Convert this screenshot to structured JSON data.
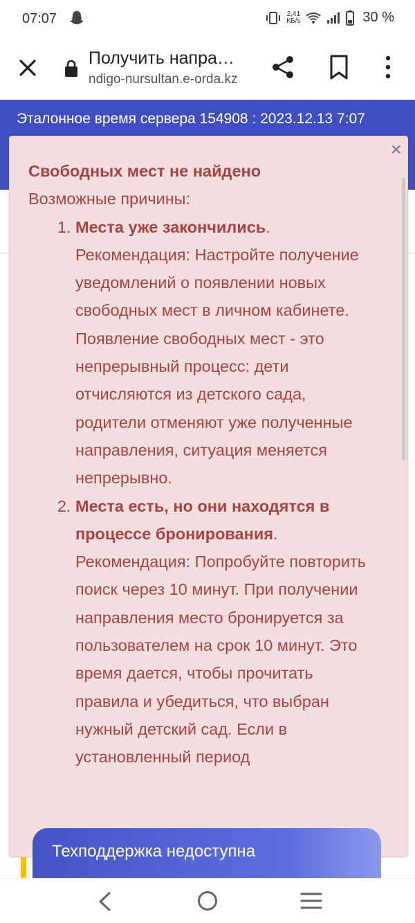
{
  "status_bar": {
    "time": "07:07",
    "speed_value": "2,41",
    "speed_unit": "КБ/s",
    "battery": "30 %"
  },
  "browser": {
    "title": "Получить напра…",
    "url": "ndigo-nursultan.e-orda.kz"
  },
  "banner": {
    "text": "Эталонное время сервера 154908 : 2023.12.13 7:07"
  },
  "alert": {
    "close": "×",
    "heading": "Свободных мест не найдено",
    "subheading": "Возможные причины:",
    "items": [
      {
        "title": "Места уже закончились",
        "text": "Рекомендация: Настройте получение уведомлений о появлении новых свободных мест в личном кабинете. Появление свободных мест - это непрерывный процесс: дети отчисляются из детского сада, родители отменяют уже полученные направления, ситуация меняется непрерывно."
      },
      {
        "title": "Места есть, но они находятся в процессе бронирования",
        "text": "Рекомендация: Попробуйте повторить поиск через 10 минут. При получении направления место бронируется за пользователем на срок 10 минут. Это время дается, чтобы прочитать правила и убедиться, что выбран нужный детский сад. Если в установленный период"
      }
    ]
  },
  "support": {
    "label": "Техподдержка недоступна"
  },
  "colors": {
    "banner_bg": "#3f4fc1",
    "alert_bg": "#f2dede",
    "alert_text": "#a94442"
  }
}
